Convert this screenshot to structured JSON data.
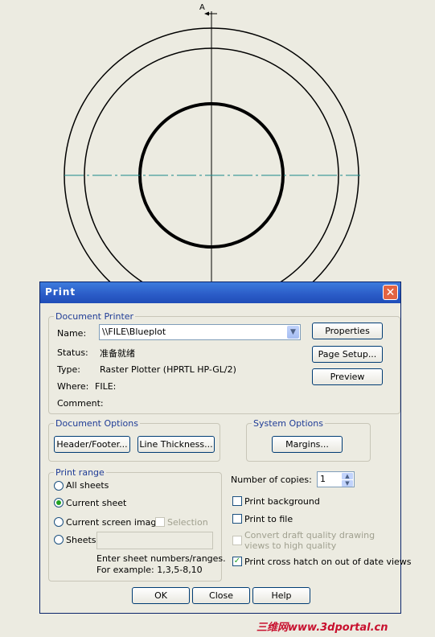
{
  "drawing": {
    "section_label": "A",
    "colors": {
      "outline": "#000000",
      "centerline": "#1a8a8a"
    }
  },
  "dialog": {
    "title": "Print",
    "close_glyph": "✕",
    "document_printer": {
      "group_label": "Document Printer",
      "name_label": "Name:",
      "name_value": "\\\\FILE\\Blueplot",
      "status_label": "Status:",
      "status_value": "准备就绪",
      "type_label": "Type:",
      "type_value": "Raster Plotter (HPRTL HP-GL/2)",
      "where_label": "Where:",
      "where_value": "FILE:",
      "comment_label": "Comment:",
      "comment_value": "",
      "properties_button": "Properties",
      "page_setup_button": "Page Setup...",
      "preview_button": "Preview"
    },
    "document_options": {
      "group_label": "Document Options",
      "header_footer_button": "Header/Footer...",
      "line_thickness_button": "Line Thickness..."
    },
    "system_options": {
      "group_label": "System Options",
      "margins_button": "Margins..."
    },
    "print_range": {
      "group_label": "Print range",
      "all_sheets": "All sheets",
      "current_sheet": "Current sheet",
      "current_screen_image": "Current screen image",
      "selection": "Selection",
      "sheets": "Sheets:",
      "sheets_value": "",
      "hint_line1": "Enter sheet numbers/ranges.",
      "hint_line2": "For example: 1,3,5-8,10",
      "selected": "current_sheet"
    },
    "copies": {
      "label": "Number of copies:",
      "value": "1"
    },
    "options": {
      "print_background": "Print background",
      "print_background_checked": false,
      "print_to_file": "Print to file",
      "print_to_file_checked": false,
      "convert_draft_line1": "Convert draft quality drawing",
      "convert_draft_line2": "views to high quality",
      "convert_draft_checked": false,
      "cross_hatch": "Print cross hatch on out of date views",
      "cross_hatch_checked": true
    },
    "buttons": {
      "ok": "OK",
      "close": "Close",
      "help": "Help"
    }
  },
  "watermark": "三维网www.3dportal.cn"
}
